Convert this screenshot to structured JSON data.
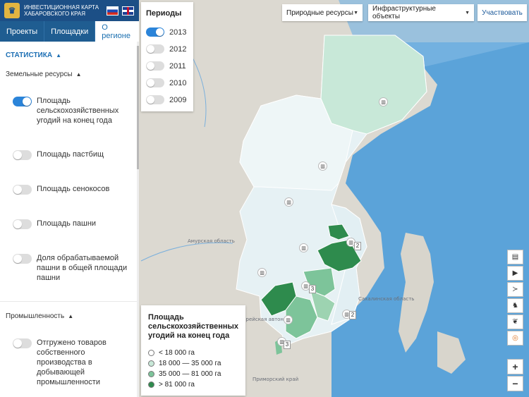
{
  "header": {
    "title": "Инвестиционная карта Хабаровского края",
    "logo_icon": "coat-of-arms-icon",
    "lang_ru_icon": "flag-ru-icon",
    "lang_en_icon": "flag-uk-icon"
  },
  "tabs": [
    {
      "label": "Проекты",
      "active": false
    },
    {
      "label": "Площадки",
      "active": false
    },
    {
      "label": "О регионе",
      "active": true
    }
  ],
  "sidebar": {
    "section_title": "Статистика",
    "groups": [
      {
        "title": "Земельные ресурсы",
        "items": [
          {
            "label": "Площадь сельскохозяйственных угодий на конец года",
            "on": true
          },
          {
            "label": "Площадь пастбищ",
            "on": false
          },
          {
            "label": "Площадь сенокосов",
            "on": false
          },
          {
            "label": "Площадь пашни",
            "on": false
          },
          {
            "label": "Доля обрабатываемой пашни в общей площади пашни",
            "on": false
          }
        ]
      },
      {
        "title": "Промышленность",
        "items": [
          {
            "label": "Отгружено товаров собственного производства в добывающей промышленности",
            "on": false
          }
        ]
      }
    ]
  },
  "periods": {
    "title": "Периоды",
    "years": [
      {
        "label": "2013",
        "on": true
      },
      {
        "label": "2012",
        "on": false
      },
      {
        "label": "2011",
        "on": false
      },
      {
        "label": "2010",
        "on": false
      },
      {
        "label": "2009",
        "on": false
      }
    ]
  },
  "toolbar": {
    "natural_resources": "Природные ресурсы",
    "infrastructure": "Инфраструктурные объекты",
    "participate": "Участвовать"
  },
  "legend": {
    "title": "Площадь сельскохозяйственных угодий на конец года",
    "items": [
      {
        "label": "< 18 000 га",
        "color": "#ffffff"
      },
      {
        "label": "18 000 — 35 000 га",
        "color": "#c8e8d8"
      },
      {
        "label": "35 000 — 81 000 га",
        "color": "#7dc49a"
      },
      {
        "label": "> 81 000 га",
        "color": "#2e8b4d"
      }
    ]
  },
  "map": {
    "labels": {
      "amur": "Амурская область",
      "sakhalin": "Сахалинская область",
      "autonomous": "Еврейская автономная область",
      "primorsky": "Приморский край"
    },
    "counts": [
      "2",
      "3",
      "2",
      "3"
    ]
  },
  "tools": [
    "book-icon",
    "play-icon",
    "fish-icon",
    "wildlife-icon",
    "plant-icon",
    "target-icon"
  ],
  "zoom": {
    "in": "+",
    "out": "−"
  }
}
